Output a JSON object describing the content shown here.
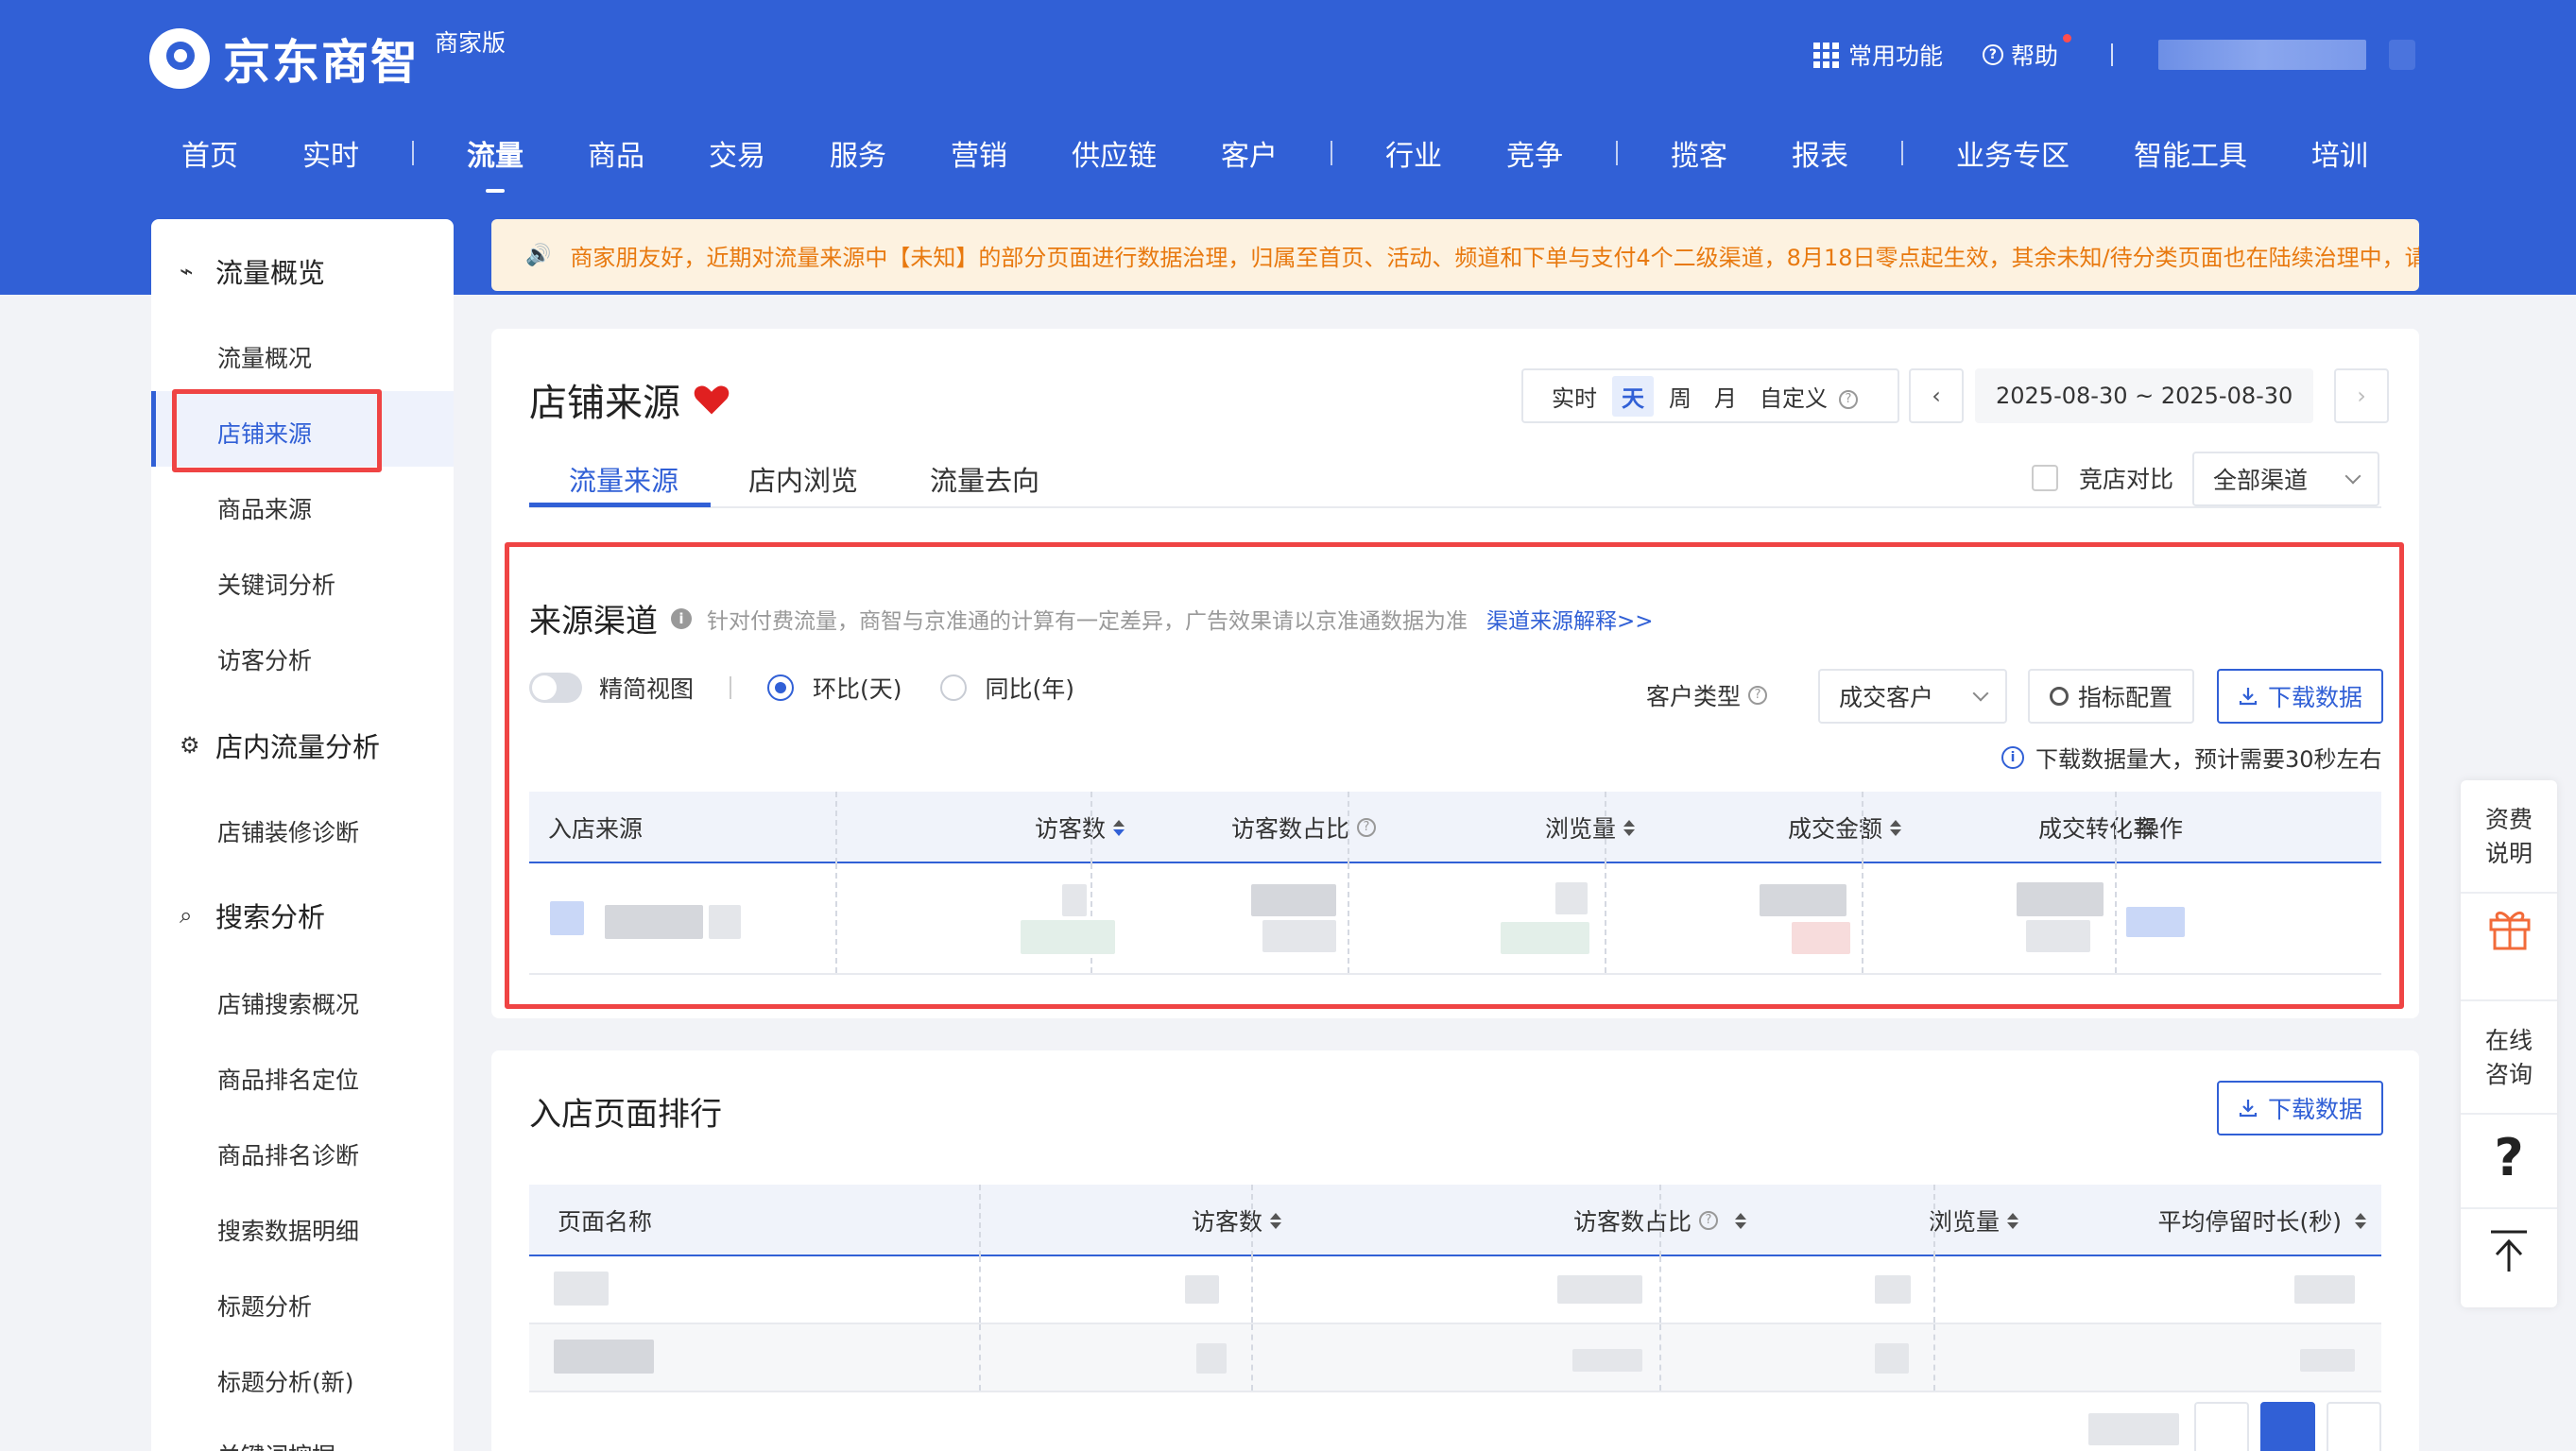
{
  "header": {
    "logo_text": "京东商智",
    "edition": "商家版",
    "common_functions": "常用功能",
    "help": "帮助"
  },
  "nav": {
    "items": [
      "首页",
      "实时",
      "流量",
      "商品",
      "交易",
      "服务",
      "营销",
      "供应链",
      "客户",
      "行业",
      "竞争",
      "揽客",
      "报表",
      "业务专区",
      "智能工具",
      "培训"
    ],
    "active": "流量"
  },
  "sidebar": {
    "group1": "流量概览",
    "group1_items": [
      "流量概况",
      "店铺来源",
      "商品来源",
      "关键词分析",
      "访客分析"
    ],
    "group2": "店内流量分析",
    "group2_items": [
      "店铺装修诊断"
    ],
    "group3": "搜索分析",
    "group3_items": [
      "店铺搜索概况",
      "商品排名定位",
      "商品排名诊断",
      "搜索数据明细",
      "标题分析",
      "标题分析(新)",
      "关键词挖掘"
    ],
    "active_item": "店铺来源"
  },
  "notice": {
    "text": "商家朋友好，近期对流量来源中【未知】的部分页面进行数据治理，归属至首页、活动、频道和下单与支付4个二级渠道，8月18日零点起生效，其余未知/待分类页面也在陆续治理中，请"
  },
  "page": {
    "title": "店铺来源",
    "period": {
      "options": [
        "实时",
        "天",
        "周",
        "月",
        "自定义"
      ],
      "selected": "天"
    },
    "date_range": "2025-08-30 ~ 2025-08-30",
    "tabs": [
      "流量来源",
      "店内浏览",
      "流量去向"
    ],
    "active_tab": "流量来源",
    "compare_label": "竞店对比",
    "channel_select": "全部渠道"
  },
  "source_section": {
    "title": "来源渠道",
    "tip": "针对付费流量，商智与京准通的计算有一定差异，广告效果请以京准通数据为准",
    "tip_link": "渠道来源解释>>",
    "simple_view": "精简视图",
    "radio_mom": "环比(天)",
    "radio_yoy": "同比(年)",
    "customer_type_label": "客户类型",
    "customer_type_value": "成交客户",
    "metric_config": "指标配置",
    "download": "下载数据",
    "download_note": "下载数据量大，预计需要30秒左右",
    "columns": [
      "入店来源",
      "访客数",
      "访客数占比",
      "浏览量",
      "成交金额",
      "成交转化率",
      "操作"
    ]
  },
  "rank_section": {
    "title": "入店页面排行",
    "download": "下载数据",
    "columns": [
      "页面名称",
      "访客数",
      "访客数占比",
      "浏览量",
      "平均停留时长(秒)"
    ]
  },
  "float_panel": {
    "fee": "资费说明",
    "consult": "在线咨询",
    "question": "?"
  },
  "colors": {
    "brand": "#3160d6",
    "highlight": "#ef4444",
    "notice_text": "#e8790f"
  }
}
